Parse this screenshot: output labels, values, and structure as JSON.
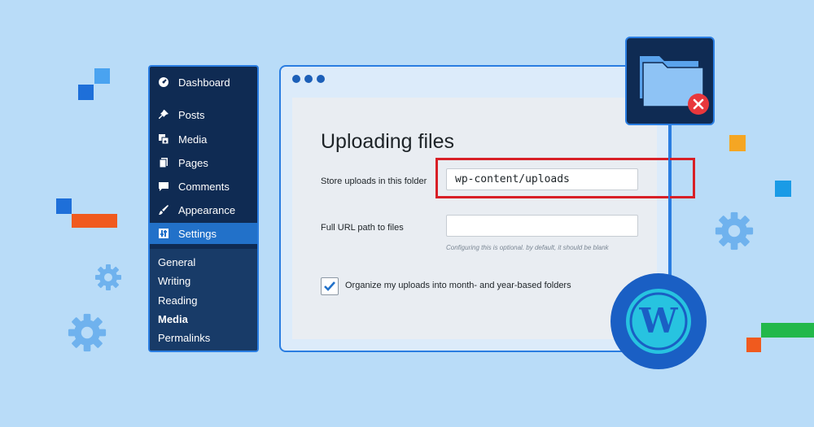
{
  "sidebar": {
    "items": [
      {
        "label": "Dashboard",
        "icon": "dashboard-icon"
      },
      {
        "label": "Posts",
        "icon": "pin-icon"
      },
      {
        "label": "Media",
        "icon": "media-icon"
      },
      {
        "label": "Pages",
        "icon": "pages-icon"
      },
      {
        "label": "Comments",
        "icon": "comment-icon"
      },
      {
        "label": "Appearance",
        "icon": "brush-icon"
      },
      {
        "label": "Settings",
        "icon": "settings-icon"
      }
    ],
    "submenu": [
      "General",
      "Writing",
      "Reading",
      "Media",
      "Permalinks"
    ],
    "active_item": "Settings",
    "active_subitem": "Media"
  },
  "window": {
    "title": "Uploading files",
    "store_label": "Store uploads in this folder",
    "store_value": "wp-content/uploads",
    "url_label": "Full URL path to files",
    "url_value": "",
    "hint": "Configuring this is optional. by default, it should be blank",
    "checkbox_label": "Organize my uploads into month- and year-based folders",
    "checkbox_checked": true
  },
  "colors": {
    "background": "#b9dcf8",
    "sidebar": "#0f2b53",
    "accent": "#2a7de1",
    "highlight": "#d81f26",
    "error": "#e8373c"
  },
  "icons": [
    "folder-icon",
    "error-x-icon",
    "wordpress-logo-icon",
    "gear-icon",
    "check-icon"
  ]
}
